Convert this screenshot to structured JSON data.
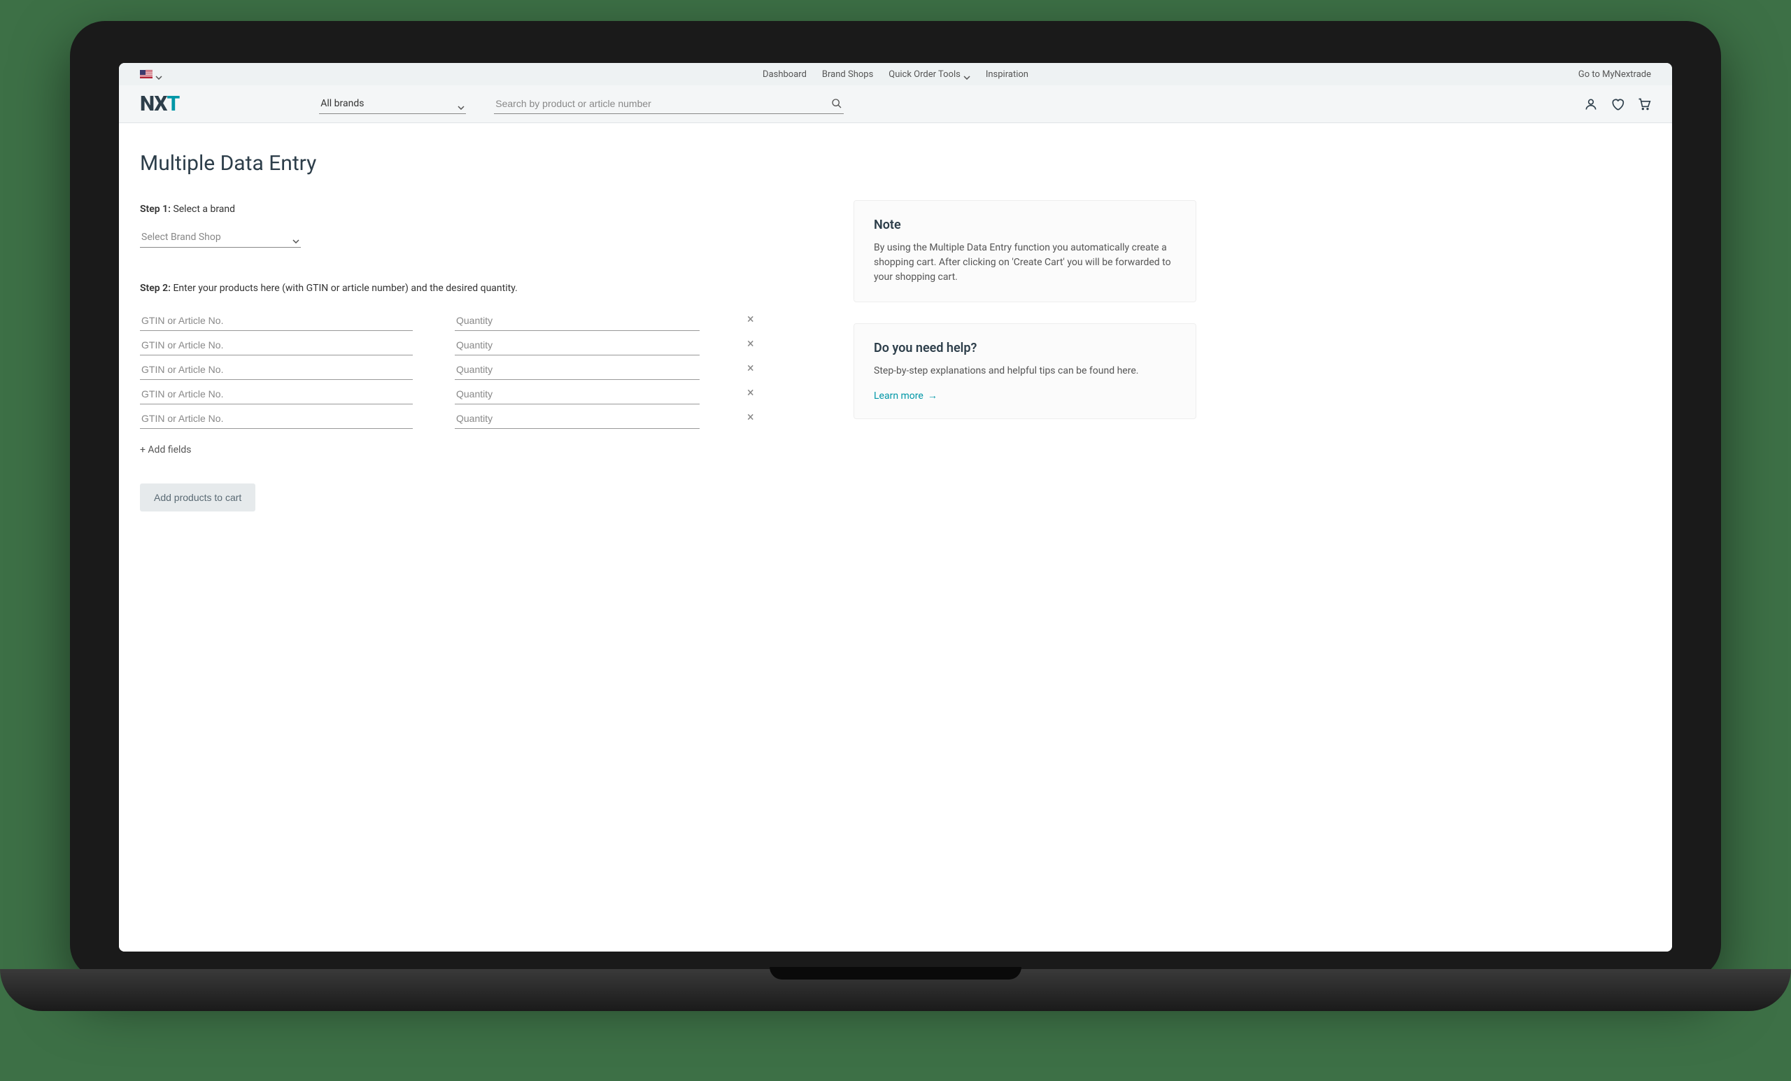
{
  "topbar": {
    "nav": {
      "dashboard": "Dashboard",
      "brand_shops": "Brand Shops",
      "quick_order": "Quick Order Tools",
      "inspiration": "Inspiration"
    },
    "right_link": "Go to MyNextrade"
  },
  "header": {
    "logo_nx": "NX",
    "logo_t": "T",
    "brand_filter": "All brands",
    "search_placeholder": "Search by product or article number"
  },
  "page": {
    "title": "Multiple Data Entry",
    "step1_label": "Step 1:",
    "step1_text": "Select a brand",
    "brand_select_placeholder": "Select Brand Shop",
    "step2_label": "Step 2:",
    "step2_text": "Enter your products here (with GTIN or article number) and the desired quantity.",
    "gtin_placeholder": "GTIN or Article No.",
    "qty_placeholder": "Quantity",
    "row_count": 5,
    "add_fields": "+ Add fields",
    "add_to_cart": "Add products to cart"
  },
  "sidebar": {
    "note": {
      "title": "Note",
      "text": "By using the Multiple Data Entry function you automatically create a shopping cart. After clicking on 'Create Cart' you will be forwarded to your shopping cart."
    },
    "help": {
      "title": "Do you need help?",
      "text": "Step-by-step explanations and helpful tips can be found here.",
      "learn_more": "Learn more"
    }
  }
}
